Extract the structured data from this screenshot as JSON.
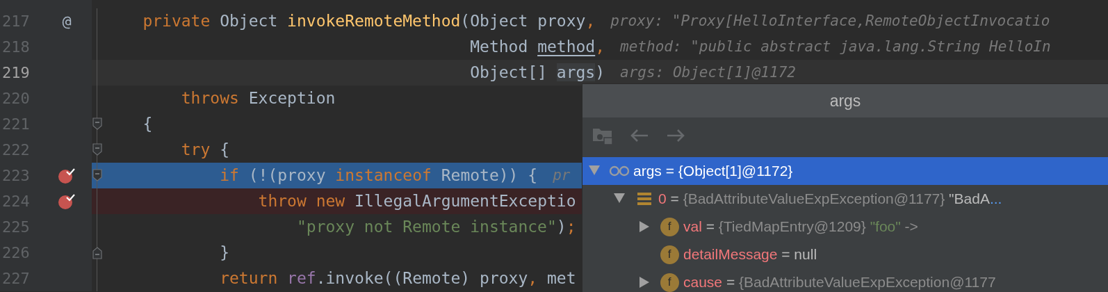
{
  "editor": {
    "lines": [
      {
        "number": "217",
        "gutter_mark": "@",
        "breakpoint": false,
        "fold_start": false,
        "fold_end": false,
        "caret": false,
        "execution": false,
        "tokens": [
          {
            "text": "    private",
            "kind": "keyword"
          },
          {
            "text": " Object ",
            "kind": "plain"
          },
          {
            "text": "invokeRemoteMethod",
            "kind": "method"
          },
          {
            "text": "(Object proxy",
            "kind": "plain"
          },
          {
            "text": ",",
            "kind": "keyword"
          }
        ],
        "hint": "proxy: \"Proxy[HelloInterface,RemoteObjectInvocatio"
      },
      {
        "number": "218",
        "breakpoint": false,
        "fold_start": false,
        "fold_end": false,
        "caret": false,
        "execution": false,
        "tokens": [
          {
            "text": "                                      Method ",
            "kind": "plain"
          },
          {
            "text": "method",
            "kind": "underlined"
          },
          {
            "text": ",",
            "kind": "keyword"
          }
        ],
        "hint": "method: \"public abstract java.lang.String HelloIn"
      },
      {
        "number": "219",
        "breakpoint": false,
        "fold_start": false,
        "fold_end": false,
        "caret": true,
        "execution": false,
        "tokens": [
          {
            "text": "                                      Object[] ",
            "kind": "plain"
          },
          {
            "text": "args",
            "kind": "marked"
          },
          {
            "text": ")",
            "kind": "plain"
          }
        ],
        "hint": "args: Object[1]@1172"
      },
      {
        "number": "220",
        "breakpoint": false,
        "fold_start": false,
        "fold_end": false,
        "caret": false,
        "execution": false,
        "tokens": [
          {
            "text": "        throws",
            "kind": "keyword"
          },
          {
            "text": " Exception",
            "kind": "plain"
          }
        ]
      },
      {
        "number": "221",
        "breakpoint": false,
        "fold_start": true,
        "fold_end": false,
        "caret": false,
        "execution": false,
        "tokens": [
          {
            "text": "    {",
            "kind": "plain"
          }
        ]
      },
      {
        "number": "222",
        "breakpoint": false,
        "fold_start": true,
        "fold_end": false,
        "caret": false,
        "execution": false,
        "tokens": [
          {
            "text": "        try",
            "kind": "keyword"
          },
          {
            "text": " {",
            "kind": "plain"
          }
        ]
      },
      {
        "number": "223",
        "breakpoint": true,
        "fold_start": true,
        "fold_end": false,
        "caret": false,
        "execution": true,
        "tokens": [
          {
            "text": "            if",
            "kind": "keyword"
          },
          {
            "text": " (!(proxy ",
            "kind": "plain"
          },
          {
            "text": "instanceof",
            "kind": "keyword"
          },
          {
            "text": " Remote)) {",
            "kind": "plain"
          }
        ],
        "hint": "pr"
      },
      {
        "number": "224",
        "breakpoint": true,
        "fold_start": false,
        "fold_end": false,
        "caret": false,
        "execution": false,
        "tokens": [
          {
            "text": "                throw new",
            "kind": "keyword"
          },
          {
            "text": " IllegalArgumentExceptio",
            "kind": "plain"
          }
        ]
      },
      {
        "number": "225",
        "breakpoint": false,
        "fold_start": false,
        "fold_end": false,
        "caret": false,
        "execution": false,
        "tokens": [
          {
            "text": "                    \"proxy not Remote instance\"",
            "kind": "string"
          },
          {
            "text": ")",
            "kind": "plain"
          },
          {
            "text": ";",
            "kind": "keyword"
          }
        ]
      },
      {
        "number": "226",
        "breakpoint": false,
        "fold_start": false,
        "fold_end": true,
        "caret": false,
        "execution": false,
        "tokens": [
          {
            "text": "            }",
            "kind": "plain"
          }
        ]
      },
      {
        "number": "227",
        "breakpoint": false,
        "fold_start": false,
        "fold_end": false,
        "caret": false,
        "execution": false,
        "tokens": [
          {
            "text": "            return ",
            "kind": "keyword"
          },
          {
            "text": "ref",
            "kind": "field"
          },
          {
            "text": ".invoke((Remote) proxy",
            "kind": "plain"
          },
          {
            "text": ", ",
            "kind": "keyword"
          },
          {
            "text": "met",
            "kind": "plain"
          }
        ]
      }
    ]
  },
  "popup": {
    "title": "args",
    "tree": [
      {
        "name": "args",
        "kind": "watch",
        "expandable": true,
        "expanded": true,
        "selected": true,
        "value": [
          {
            "text": " = {Object[1]@1172}",
            "kind": "plain"
          }
        ],
        "children": [
          {
            "name": "0",
            "kind": "array",
            "expandable": true,
            "expanded": true,
            "selected": false,
            "value": [
              {
                "text": " = ",
                "kind": "plain"
              },
              {
                "text": "{BadAttributeValueExpException@1177}",
                "kind": "type"
              },
              {
                "text": " \"BadA",
                "kind": "plain"
              },
              {
                "text": "...",
                "kind": "more"
              }
            ],
            "children": [
              {
                "name": "val",
                "kind": "field",
                "badge": "f",
                "expandable": true,
                "expanded": false,
                "selected": false,
                "value": [
                  {
                    "text": " = ",
                    "kind": "plain"
                  },
                  {
                    "text": "{TiedMapEntry@1209}",
                    "kind": "type"
                  },
                  {
                    "text": " \"foo\"",
                    "kind": "string"
                  },
                  {
                    "text": " ->",
                    "kind": "type"
                  }
                ]
              },
              {
                "name": "detailMessage",
                "kind": "field",
                "badge": "f",
                "expandable": false,
                "selected": false,
                "value": [
                  {
                    "text": " = null",
                    "kind": "plain"
                  }
                ]
              },
              {
                "name": "cause",
                "kind": "field",
                "badge": "f",
                "expandable": true,
                "expanded": false,
                "selected": false,
                "value": [
                  {
                    "text": " = ",
                    "kind": "plain"
                  },
                  {
                    "text": "{BadAttributeValueExpException@1177",
                    "kind": "type"
                  }
                ]
              }
            ]
          }
        ]
      }
    ]
  }
}
